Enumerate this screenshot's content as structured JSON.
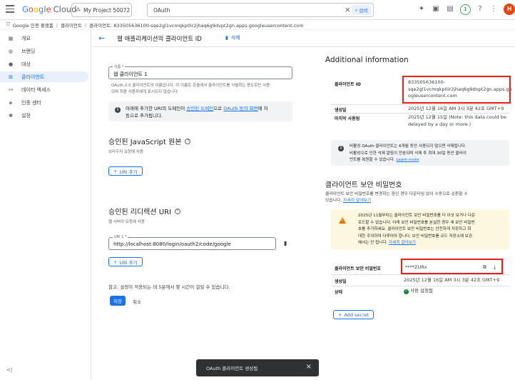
{
  "header": {
    "logo_google": "Google",
    "logo_cloud": "Cloud",
    "project": "My Project 50072",
    "search_value": "OAuth",
    "search_button": "검색",
    "notification_count": "1",
    "avatar_letter": "H"
  },
  "breadcrumb": [
    "Google 인증 플랫폼",
    "클라이언트",
    "클라이언트: 833505636100-sqe2gl1vcmqkp0ir2jhaq6g9dvpt2gn.apps.googleusercontent.com"
  ],
  "sidebar": {
    "items": [
      {
        "label": "개요",
        "icon": "grid-icon"
      },
      {
        "label": "브랜딩",
        "icon": "palette-icon"
      },
      {
        "label": "대상",
        "icon": "person-icon"
      },
      {
        "label": "클라이언트",
        "icon": "key-icon"
      },
      {
        "label": "데이터 액세스",
        "icon": "data-icon"
      },
      {
        "label": "인증 센터",
        "icon": "shield-icon"
      },
      {
        "label": "설정",
        "icon": "gear-icon"
      }
    ],
    "active_index": 3,
    "collapse_label": "<|"
  },
  "page": {
    "title": "웹 애플리케이션의 클라이언트 ID",
    "delete_label": "삭제"
  },
  "form": {
    "name_label": "이름 *",
    "name_value": "웹 클라이언트 1",
    "name_help_1": "OAuth 2.0 클라이언트의 이름입니다. 이 이름은 콘솔에서 클라이언트를 식별하는 용도로만 사용",
    "name_help_2": "되며 최종 사용자에게 표시되지 않습니다.",
    "notice_1": "아래에 추가한 URI의 도메인이",
    "notice_link1": "승인된 도메인",
    "notice_2": "으로",
    "notice_link2": "OAuth 동의 화면",
    "notice_3": "에 자",
    "notice_4": "동으로 추가됩니다.",
    "js_title": "승인된 JavaScript 원본",
    "js_sub": "브라우저 요청에 사용",
    "add_uri": "URI 추가",
    "redirect_title": "승인된 리디렉션 URI",
    "redirect_sub": "웹 서버의 요청에 사용",
    "uri_label": "URI 1 *",
    "uri_value": "http://localhost:8080/login/oauth2/code/google",
    "note": "참고: 설정이 적용되는 데 5분에서 몇 시간이 걸릴 수 있습니다.",
    "save": "저장",
    "cancel": "취소"
  },
  "info": {
    "title": "Additional information",
    "client_id_label": "클라이언트 ID",
    "client_id_lines": [
      "833505636100-",
      "sqe2gl1vcmqkp0ir2jhaq6g9dvpt2gn.apps.go",
      "ogleusercontent.com"
    ],
    "created_label": "생성일",
    "created_value": "2025년 12월 16일 AM 3시 3분 42초 GMT+9",
    "last_used_label": "마지막 사용됨",
    "last_used_lines": [
      "2025년 12월 15일 (Note: this data could be",
      "delayed by a day or more.)"
    ],
    "inactive_lines": [
      "비활성 OAuth 클라이언트는 6개월 동안 사용되지 않으면 삭제됩니다.",
      "비활성으로 인한 삭제 알림이 전송되며 삭제 후 최대 30일 동안 클라이",
      "언트를 복원할 수 있습니다."
    ],
    "learn_more": "Learn more",
    "secret_title": "클라이언트 보안 비밀번호",
    "secret_desc_1": "클라이언트 보안 비밀번호를 변경하는 중인 경우 다운타임 없이 수동으로 순환할 수",
    "secret_desc_2": "있습니다.",
    "secret_learn": "자세히 알아보기",
    "warn_lines": [
      "2025년 11월부터는 클라이언트 보안 비밀번호를 더 이상 보거나 다운",
      "로드할 수 없습니다. 아래 보안 비밀번호를 분실한 경우 새 보안 비밀번",
      "호를 추가하세요. 클라이언트 보안 비밀번호는 안전하게 저장하고 최",
      "대한 주의하여 다루어야 합니다. 보안 비밀번호를 코드 저장소에 보관",
      "해서는 안 됩니다."
    ],
    "warn_link": "자세히 알아보기",
    "secret_label": "클라이언트 보안 비밀번호",
    "secret_value": "****ZURx",
    "secret_created_label": "생성일",
    "secret_created_value": "2025년 12월 16일 AM 3시 3분 42초 GMT+9",
    "status_label": "상태",
    "status_value": "사용 설정됨",
    "add_secret": "Add secret"
  },
  "toast": {
    "message": "OAuth 클라이언트 생성됨"
  }
}
